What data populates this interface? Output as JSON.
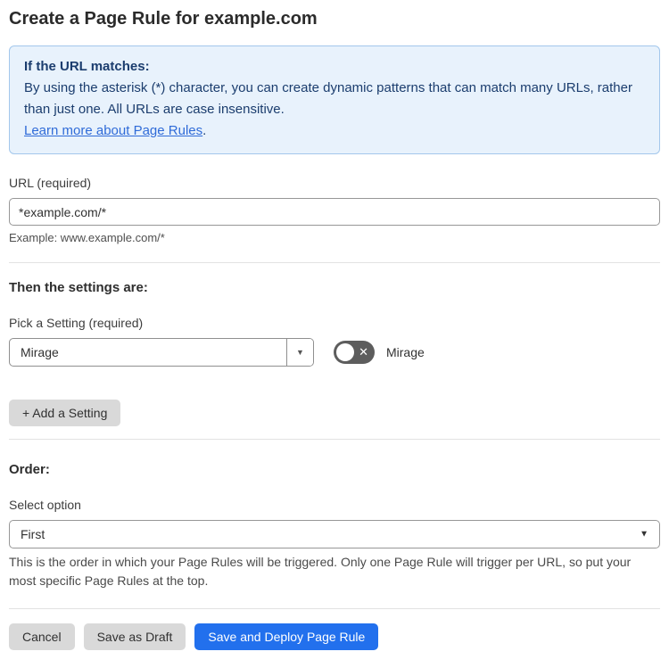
{
  "page": {
    "title": "Create a Page Rule for example.com"
  },
  "info_box": {
    "heading": "If the URL matches:",
    "body": "By using the asterisk (*) character, you can create dynamic patterns that can match many URLs, rather than just one. All URLs are case insensitive.",
    "link_label": "Learn more about Page Rules",
    "link_suffix": "."
  },
  "url_field": {
    "label": "URL (required)",
    "value": "*example.com/*",
    "helper": "Example: www.example.com/*"
  },
  "settings_section": {
    "heading": "Then the settings are:",
    "pick_label": "Pick a Setting (required)",
    "selected_setting": "Mirage",
    "dropdown_caret": "▼",
    "toggle_state": "off",
    "toggle_glyph": "✕",
    "toggle_label": "Mirage",
    "add_button_label": "+ Add a Setting"
  },
  "order_section": {
    "heading": "Order:",
    "select_label": "Select option",
    "selected_option": "First",
    "caret": "▼",
    "helper": "This is the order in which your Page Rules will be triggered. Only one Page Rule will trigger per URL, so put your most specific Page Rules at the top."
  },
  "actions": {
    "cancel_label": "Cancel",
    "save_draft_label": "Save as Draft",
    "deploy_label": "Save and Deploy Page Rule"
  },
  "colors": {
    "info_bg": "#e8f2fc",
    "info_border": "#a3c7ec",
    "info_text": "#1b3d6e",
    "link": "#2f6bd8",
    "primary_button": "#2270ed",
    "gray_button": "#d9d9d9",
    "toggle_off": "#5d5d5d"
  }
}
